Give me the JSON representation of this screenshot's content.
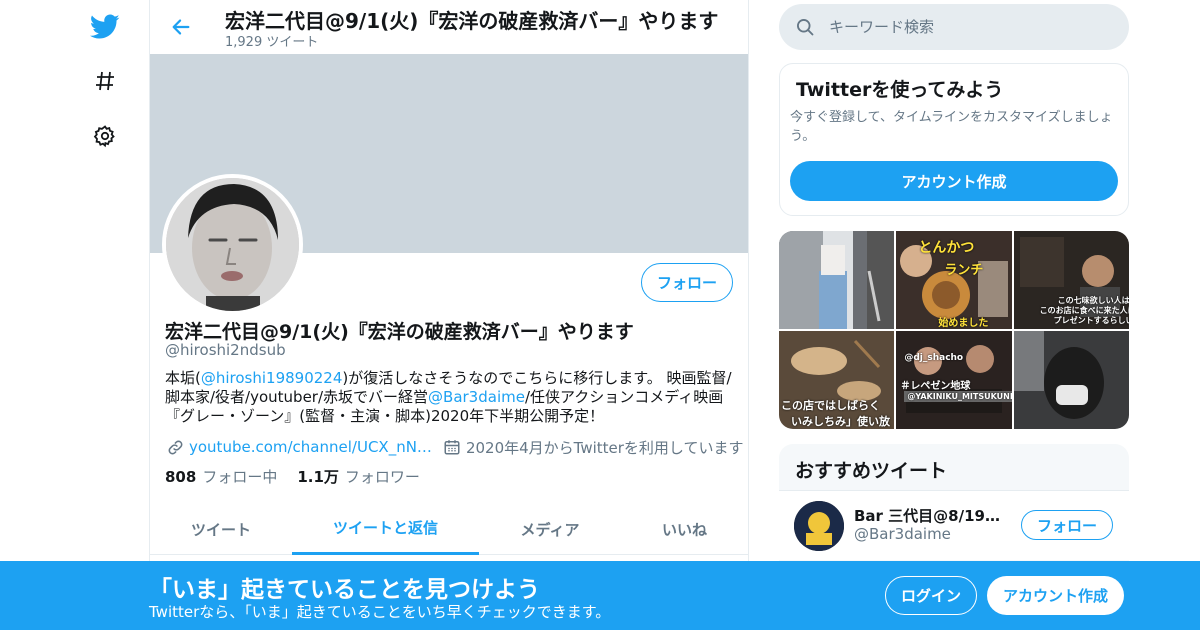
{
  "colors": {
    "accent": "#1da1f2",
    "banner": "#ccd6dd",
    "muted": "#657786",
    "text": "#14171a"
  },
  "icons": {
    "logo": "twitter-bird-icon",
    "explore": "hashtag-icon",
    "settings": "gear-icon",
    "back": "back-arrow-icon",
    "search": "search-icon",
    "link": "link-icon",
    "calendar": "calendar-icon"
  },
  "header": {
    "title": "宏洋二代目@9/1(火)『宏洋の破産救済バー』やります",
    "tweet_count": "1,929 ツイート"
  },
  "profile": {
    "follow_label": "フォロー",
    "display_name": "宏洋二代目@9/1(火)『宏洋の破産救済バー』やります",
    "handle": "@hiroshi2ndsub",
    "bio": {
      "p1": "本垢(",
      "mention1": "@hiroshi19890224",
      "p2": ")が復活しなさそうなのでこちらに移行します。 映画監督/脚本家/役者/youtuber/赤坂でバー経営",
      "mention2": "@Bar3daime",
      "p3": "/任侠アクションコメディ映画『グレー・ゾーン』(監督・主演・脚本)2020年下半期公開予定！"
    },
    "website": "youtube.com/channel/UCX_nN…",
    "joined": "2020年4月からTwitterを利用しています",
    "following_count": "808",
    "following_label": "フォロー中",
    "followers_count": "1.1万",
    "followers_label": "フォロワー"
  },
  "tabs": [
    {
      "label": "ツイート",
      "active": false
    },
    {
      "label": "ツイートと返信",
      "active": true
    },
    {
      "label": "メディア",
      "active": false
    },
    {
      "label": "いいね",
      "active": false
    }
  ],
  "search": {
    "placeholder": "キーワード検索"
  },
  "signup_card": {
    "title": "Twitterを使ってみよう",
    "description": "今すぐ登録して、タイムラインをカスタマイズしましょう。",
    "button": "アカウント作成"
  },
  "media_captions": {
    "t2a": "とんかつ",
    "t2b": "ランチ",
    "t2c": "始めました",
    "t3a": "この七味欲しい人は",
    "t3b": "このお店に食べに来た人に",
    "t3c": "プレゼントするらしい",
    "t4a": "この店ではしばらく",
    "t4b": "いみしちみ」使い放",
    "t5a": "@dj_shacho",
    "t5b": "＃レペゼン地球",
    "t5c": "@YAKINIKU_MITSUKUNI"
  },
  "recommended": {
    "title": "おすすめツイート",
    "items": [
      {
        "name": "Bar 三代目@8/19し…",
        "handle": "@Bar3daime",
        "follow_label": "フォロー"
      }
    ]
  },
  "bottom_bar": {
    "title": "「いま」起きていることを見つけよう",
    "subtitle": "Twitterなら、「いま」起きていることをいち早くチェックできます。",
    "login": "ログイン",
    "signup": "アカウント作成"
  }
}
